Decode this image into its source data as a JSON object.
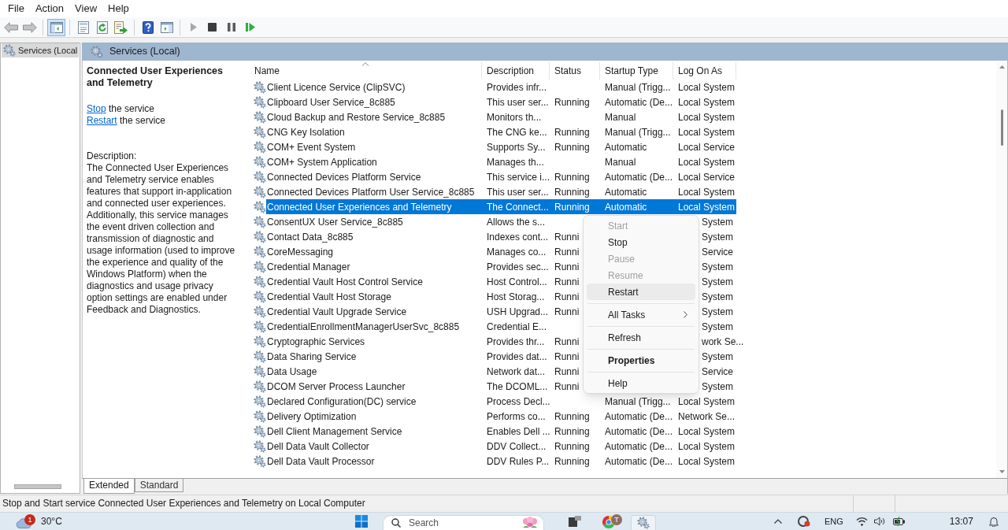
{
  "menu": [
    "File",
    "Action",
    "View",
    "Help"
  ],
  "toolbar": [
    {
      "kind": "back",
      "disabled": true,
      "pressed": false
    },
    {
      "kind": "forward",
      "disabled": true,
      "pressed": false
    },
    {
      "kind": "separator"
    },
    {
      "kind": "console_tree",
      "disabled": false,
      "pressed": true
    },
    {
      "kind": "separator"
    },
    {
      "kind": "properties",
      "disabled": false,
      "pressed": false
    },
    {
      "kind": "refresh",
      "disabled": false,
      "pressed": false
    },
    {
      "kind": "export",
      "disabled": false,
      "pressed": false
    },
    {
      "kind": "separator"
    },
    {
      "kind": "help",
      "disabled": false,
      "pressed": false
    },
    {
      "kind": "action_pane",
      "disabled": false,
      "pressed": false
    },
    {
      "kind": "separator"
    },
    {
      "kind": "start",
      "disabled": true,
      "pressed": false
    },
    {
      "kind": "stop",
      "disabled": false,
      "pressed": false
    },
    {
      "kind": "pause",
      "disabled": false,
      "pressed": false
    },
    {
      "kind": "resume",
      "disabled": false,
      "pressed": false
    }
  ],
  "tree": [
    {
      "label": "Services (Local",
      "selected": true
    }
  ],
  "pane_header": {
    "title": "Services (Local)"
  },
  "details": {
    "title": "Connected User Experiences and Telemetry",
    "actions": [
      {
        "link": "Stop",
        "text": "the service"
      },
      {
        "link": "Restart",
        "text": "the service"
      }
    ],
    "description_label": "Description:",
    "description": "The Connected User Experiences and Telemetry service enables features that support in-application and connected user experiences. Additionally, this service manages the event driven collection and transmission of diagnostic and usage information (used to improve the experience and quality of the Windows Platform) when the diagnostics and usage privacy option settings are enabled under Feedback and Diagnostics."
  },
  "table": {
    "columns": [
      {
        "label": "Name",
        "sorted": true
      },
      {
        "label": "Description",
        "sorted": false
      },
      {
        "label": "Status",
        "sorted": false
      },
      {
        "label": "Startup Type",
        "sorted": false
      },
      {
        "label": "Log On As",
        "sorted": false
      }
    ],
    "rows": [
      {
        "name": "Client Licence Service (ClipSVC)",
        "description": "Provides infr...",
        "startup_type": "Manual (Trigg...",
        "log_on_as": "Local System",
        "selected": false
      },
      {
        "name": "Clipboard User Service_8c885",
        "description": "This user ser...",
        "status": "Running",
        "startup_type": "Automatic (De...",
        "log_on_as": "Local System",
        "selected": false
      },
      {
        "name": "Cloud Backup and Restore Service_8c885",
        "description": "Monitors th...",
        "startup_type": "Manual",
        "log_on_as": "Local System",
        "selected": false
      },
      {
        "name": "CNG Key Isolation",
        "description": "The CNG ke...",
        "status": "Running",
        "startup_type": "Manual (Trigg...",
        "log_on_as": "Local System",
        "selected": false
      },
      {
        "name": "COM+ Event System",
        "description": "Supports Sy...",
        "status": "Running",
        "startup_type": "Automatic",
        "log_on_as": "Local Service",
        "selected": false
      },
      {
        "name": "COM+ System Application",
        "description": "Manages th...",
        "startup_type": "Manual",
        "log_on_as": "Local System",
        "selected": false
      },
      {
        "name": "Connected Devices Platform Service",
        "description": "This service i...",
        "status": "Running",
        "startup_type": "Automatic (De...",
        "log_on_as": "Local Service",
        "selected": false
      },
      {
        "name": "Connected Devices Platform User Service_8c885",
        "description": "This user ser...",
        "status": "Running",
        "startup_type": "Automatic",
        "log_on_as": "Local System",
        "selected": false
      },
      {
        "name": "Connected User Experiences and Telemetry",
        "description": "The Connect...",
        "status": "Running",
        "startup_type": "Automatic",
        "log_on_as": "Local System",
        "selected": true
      },
      {
        "name": "ConsentUX User Service_8c885",
        "description": "Allows the s...",
        "log_on_as": "System",
        "selected": false
      },
      {
        "name": "Contact Data_8c885",
        "description": "Indexes cont...",
        "status": "Runni",
        "log_on_as": "System",
        "selected": false
      },
      {
        "name": "CoreMessaging",
        "description": "Manages co...",
        "status": "Runni",
        "log_on_as": "Service",
        "selected": false
      },
      {
        "name": "Credential Manager",
        "description": "Provides sec...",
        "status": "Runni",
        "log_on_as": "System",
        "selected": false
      },
      {
        "name": "Credential Vault Host Control Service",
        "description": "Host Control...",
        "status": "Runni",
        "log_on_as": "System",
        "selected": false
      },
      {
        "name": "Credential Vault Host Storage",
        "description": "Host Storag...",
        "status": "Runni",
        "log_on_as": "System",
        "selected": false
      },
      {
        "name": "Credential Vault Upgrade Service",
        "description": "USH Upgrad...",
        "status": "Runni",
        "log_on_as": "System",
        "selected": false
      },
      {
        "name": "CredentialEnrollmentManagerUserSvc_8c885",
        "description": "Credential E...",
        "log_on_as": "System",
        "selected": false
      },
      {
        "name": "Cryptographic Services",
        "description": "Provides thr...",
        "status": "Runni",
        "log_on_as": "work Se...",
        "selected": false
      },
      {
        "name": "Data Sharing Service",
        "description": "Provides dat...",
        "status": "Runni",
        "log_on_as": "System",
        "selected": false
      },
      {
        "name": "Data Usage",
        "description": "Network dat...",
        "status": "Runni",
        "log_on_as": "Service",
        "selected": false
      },
      {
        "name": "DCOM Server Process Launcher",
        "description": "The DCOML...",
        "status": "Runni",
        "log_on_as": "System",
        "selected": false
      },
      {
        "name": "Declared Configuration(DC) service",
        "description": "Process Decl...",
        "startup_type": "Manual (Trigg...",
        "log_on_as": "Local System",
        "selected": false
      },
      {
        "name": "Delivery Optimization",
        "description": "Performs co...",
        "status": "Running",
        "startup_type": "Automatic (De...",
        "log_on_as": "Network Se...",
        "selected": false
      },
      {
        "name": "Dell Client Management Service",
        "description": "Enables Dell ...",
        "status": "Running",
        "startup_type": "Automatic (De...",
        "log_on_as": "Local System",
        "selected": false
      },
      {
        "name": "Dell Data Vault Collector",
        "description": "DDV Collect...",
        "status": "Running",
        "startup_type": "Automatic (De...",
        "log_on_as": "Local System",
        "selected": false
      },
      {
        "name": "Dell Data Vault Processor",
        "description": "DDV Rules P...",
        "status": "Running",
        "startup_type": "Automatic (De...",
        "log_on_as": "Local System",
        "selected": false
      }
    ]
  },
  "context_menu": [
    {
      "kind": "item",
      "label": "Start",
      "disabled": true,
      "highlighted": false,
      "default": false
    },
    {
      "kind": "item",
      "label": "Stop",
      "disabled": false,
      "highlighted": false,
      "default": false
    },
    {
      "kind": "item",
      "label": "Pause",
      "disabled": true,
      "highlighted": false,
      "default": false
    },
    {
      "kind": "item",
      "label": "Resume",
      "disabled": true,
      "highlighted": false,
      "default": false
    },
    {
      "kind": "item",
      "label": "Restart",
      "disabled": false,
      "highlighted": true,
      "default": false
    },
    {
      "kind": "separator"
    },
    {
      "kind": "submenu",
      "label": "All Tasks",
      "disabled": false,
      "highlighted": false,
      "default": false
    },
    {
      "kind": "separator"
    },
    {
      "kind": "item",
      "label": "Refresh",
      "disabled": false,
      "highlighted": false,
      "default": false
    },
    {
      "kind": "separator"
    },
    {
      "kind": "item",
      "label": "Properties",
      "disabled": false,
      "highlighted": false,
      "default": true
    },
    {
      "kind": "separator"
    },
    {
      "kind": "item",
      "label": "Help",
      "disabled": false,
      "highlighted": false,
      "default": false
    }
  ],
  "tabs": [
    {
      "label": "Extended",
      "selected": true
    },
    {
      "label": "Standard",
      "selected": false
    }
  ],
  "status_bar": {
    "text": "Stop and Start service Connected User Experiences and Telemetry on Local Computer"
  },
  "taskbar": {
    "weather_badge": "1",
    "temperature": "30°C",
    "search_placeholder": "Search",
    "browser_badge": "T",
    "settings_active": true,
    "language": "ENG",
    "time": "13:07"
  }
}
